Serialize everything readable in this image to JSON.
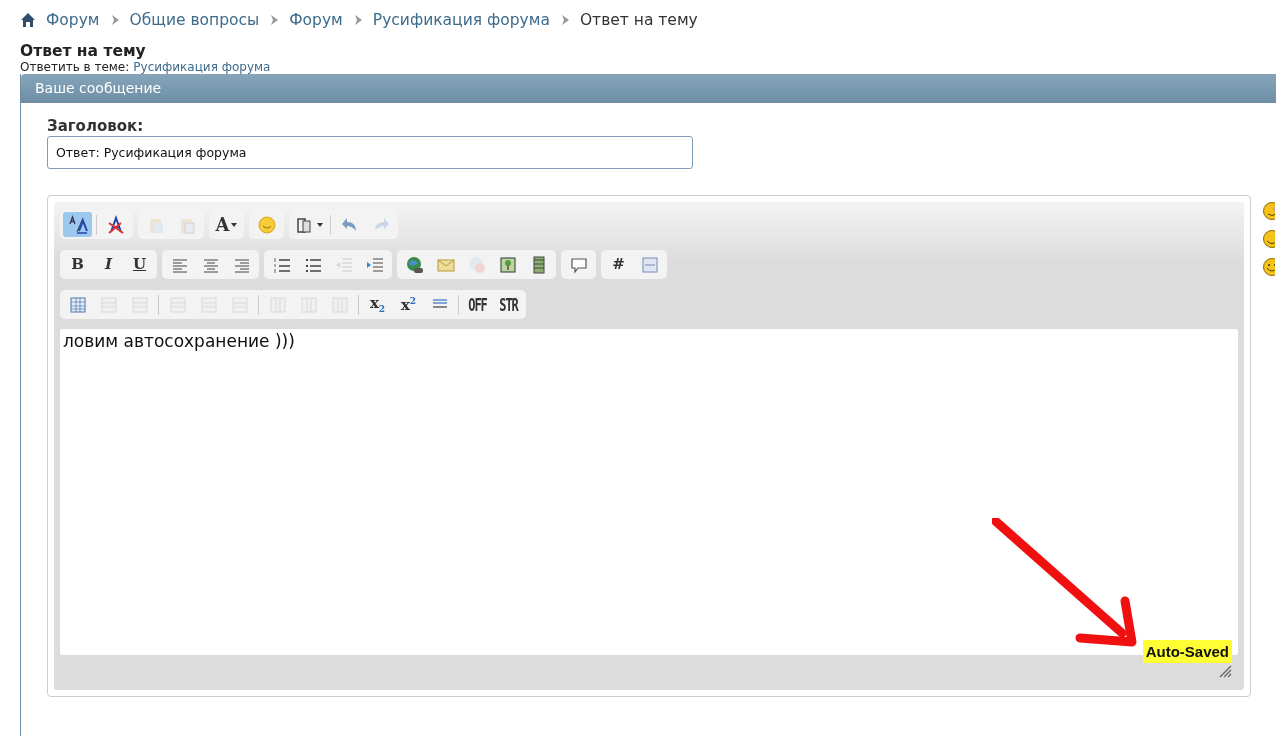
{
  "breadcrumb": [
    {
      "label": "Форум",
      "link": true
    },
    {
      "label": "Общие вопросы",
      "link": true
    },
    {
      "label": "Форум",
      "link": true
    },
    {
      "label": "Русификация форума",
      "link": true
    },
    {
      "label": "Ответ на тему",
      "link": false
    }
  ],
  "page_title": "Ответ на тему",
  "subtitle": {
    "prefix": "Ответить в теме:",
    "link": "Русификация форума"
  },
  "panel": {
    "title": "Ваше сообщение"
  },
  "subject": {
    "label": "Заголовок:",
    "value": "Ответ: Русификация форума"
  },
  "toolbars": [
    [
      [
        {
          "kind": "text-size",
          "selected": true,
          "disabled": false
        },
        {
          "kind": "separator"
        },
        {
          "kind": "remove-format",
          "selected": false,
          "disabled": false
        }
      ],
      [
        {
          "kind": "paste",
          "selected": false,
          "disabled": true
        },
        {
          "kind": "paste-text",
          "selected": false,
          "disabled": true
        }
      ],
      [
        {
          "kind": "font",
          "label": "A",
          "caret": true,
          "selected": false,
          "disabled": false
        }
      ],
      [
        {
          "kind": "smiley",
          "selected": false,
          "disabled": false
        }
      ],
      [
        {
          "kind": "attach",
          "caret": true,
          "selected": false,
          "disabled": false
        },
        {
          "kind": "separator"
        },
        {
          "kind": "undo",
          "selected": false,
          "disabled": false
        },
        {
          "kind": "redo",
          "selected": false,
          "disabled": true
        }
      ]
    ],
    [
      [
        {
          "kind": "bold",
          "label": "B",
          "selected": false,
          "disabled": false
        },
        {
          "kind": "italic",
          "label": "I",
          "selected": false,
          "disabled": false
        },
        {
          "kind": "underline",
          "label": "U",
          "selected": false,
          "disabled": false
        }
      ],
      [
        {
          "kind": "align-left",
          "selected": false,
          "disabled": false
        },
        {
          "kind": "align-center",
          "selected": false,
          "disabled": false
        },
        {
          "kind": "align-right",
          "selected": false,
          "disabled": false
        }
      ],
      [
        {
          "kind": "ordered-list",
          "selected": false,
          "disabled": false
        },
        {
          "kind": "bullet-list",
          "selected": false,
          "disabled": false
        },
        {
          "kind": "outdent",
          "selected": false,
          "disabled": true
        },
        {
          "kind": "indent",
          "selected": false,
          "disabled": false
        }
      ],
      [
        {
          "kind": "link",
          "selected": false,
          "disabled": false
        },
        {
          "kind": "email",
          "selected": false,
          "disabled": false
        },
        {
          "kind": "unlink",
          "selected": false,
          "disabled": true
        },
        {
          "kind": "image",
          "selected": false,
          "disabled": false
        },
        {
          "kind": "media",
          "selected": false,
          "disabled": false
        }
      ],
      [
        {
          "kind": "quote",
          "selected": false,
          "disabled": false
        }
      ],
      [
        {
          "kind": "code",
          "label": "#",
          "selected": false,
          "disabled": false
        },
        {
          "kind": "php",
          "selected": false,
          "disabled": false
        }
      ]
    ],
    [
      [
        {
          "kind": "table",
          "selected": false,
          "disabled": false
        },
        {
          "kind": "table-row",
          "selected": false,
          "disabled": true
        },
        {
          "kind": "table-row",
          "selected": false,
          "disabled": true
        },
        {
          "kind": "separator"
        },
        {
          "kind": "table-row",
          "selected": false,
          "disabled": true
        },
        {
          "kind": "table-row",
          "selected": false,
          "disabled": true
        },
        {
          "kind": "table-row",
          "selected": false,
          "disabled": true
        },
        {
          "kind": "separator"
        },
        {
          "kind": "table-col",
          "selected": false,
          "disabled": true
        },
        {
          "kind": "table-col",
          "selected": false,
          "disabled": true
        },
        {
          "kind": "table-col",
          "selected": false,
          "disabled": true
        },
        {
          "kind": "separator"
        },
        {
          "kind": "subscript",
          "label": "x$_{2}$",
          "selected": false,
          "disabled": false
        },
        {
          "kind": "superscript",
          "label": "x$^{2}$",
          "selected": false,
          "disabled": false
        },
        {
          "kind": "rule",
          "selected": false,
          "disabled": false
        },
        {
          "kind": "separator"
        },
        {
          "kind": "noparse",
          "label": "OFF",
          "selected": false,
          "disabled": false
        },
        {
          "kind": "strike",
          "label": "STR",
          "selected": false,
          "disabled": false
        }
      ]
    ]
  ],
  "message": "ловим автосохранение )))",
  "autosave": "Auto-Saved",
  "smilies": [
    {
      "kind": "wink"
    },
    {
      "kind": "grin"
    },
    {
      "kind": "smile"
    }
  ]
}
